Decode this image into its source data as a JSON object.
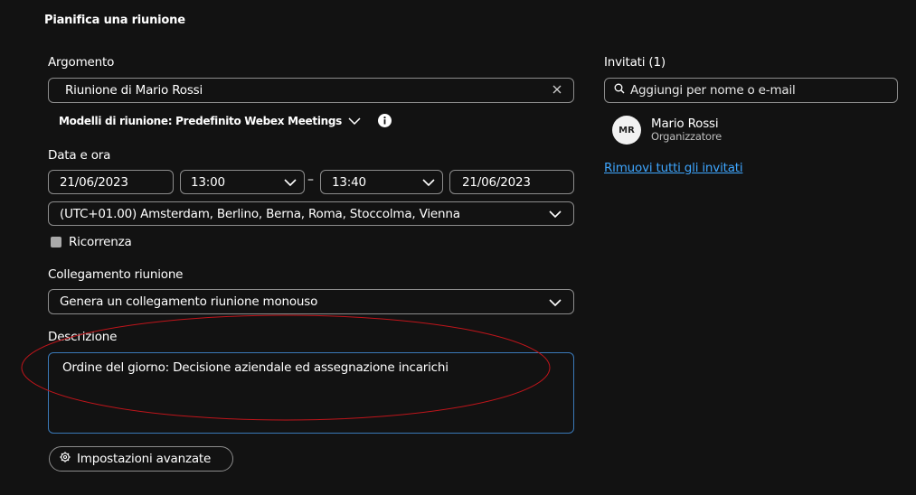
{
  "page": {
    "title": "Pianifica una riunione"
  },
  "topic": {
    "label": "Argomento",
    "value": "Riunione di Mario Rossi",
    "clear_icon": "close-icon"
  },
  "templates": {
    "text": "Modelli di riunione: Predefinito Webex Meetings",
    "icon": "chevron-down-icon",
    "info_icon": "info-icon"
  },
  "datetime": {
    "label": "Data e ora",
    "start_date": "21/06/2023",
    "start_time": "13:00",
    "separator": "–",
    "end_time": "13:40",
    "end_date": "21/06/2023",
    "timezone": "(UTC+01.00) Amsterdam, Berlino, Berna, Roma, Stoccolma, Vienna"
  },
  "recurrence": {
    "label": "Ricorrenza",
    "checked": false
  },
  "meeting_link": {
    "label": "Collegamento riunione",
    "value": "Genera un collegamento riunione monouso"
  },
  "description": {
    "label": "Descrizione",
    "value": "Ordine del giorno: Decisione aziendale ed assegnazione incarichi"
  },
  "advanced": {
    "label": "Impostazioni avanzate",
    "icon": "gear-icon"
  },
  "invitees": {
    "header": "Invitati (1)",
    "search_placeholder": "Aggiungi per nome o e-mail",
    "search_icon": "search-icon",
    "list": [
      {
        "initials": "MR",
        "name": "Mario Rossi",
        "role": "Organizzatore"
      }
    ],
    "remove_all": "Rimuovi tutti gli invitati"
  },
  "colors": {
    "background": "#121212",
    "field_border": "#8c8c8c",
    "focus_border": "#3a79b8",
    "link": "#3ea6ff",
    "annotation": "#c0151b"
  }
}
